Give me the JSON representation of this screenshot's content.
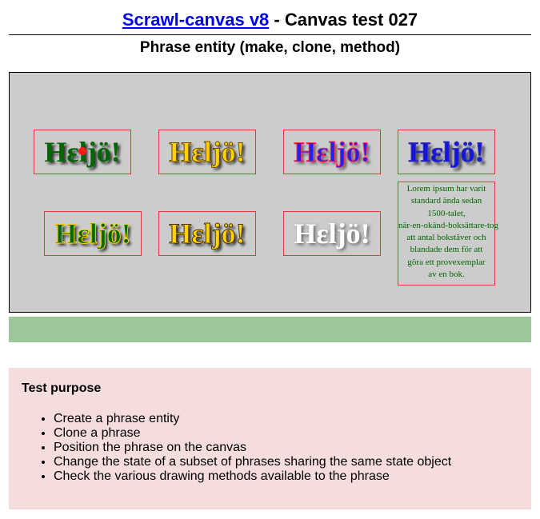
{
  "header": {
    "link_text": "Scrawl-canvas v8",
    "title_suffix": " - Canvas test 027",
    "subtitle": "Phrase entity (make, clone, method)"
  },
  "canvas": {
    "phrases": [
      {
        "text": "Hεljö!",
        "method": "fill"
      },
      {
        "text": "Hεljö!",
        "method": "draw"
      },
      {
        "text": "Hεljö!",
        "method": "drawAndFill"
      },
      {
        "text": "Hεljö!",
        "method": "fillAndDraw"
      },
      {
        "text": "Hεljö!",
        "method": "drawThenFill"
      },
      {
        "text": "Hεljö!",
        "method": "fillThenDraw"
      },
      {
        "text": "Hεljö!",
        "method": "clear"
      }
    ],
    "lorem_lines": [
      "Lorem ipsum har varit",
      "standard ända sedan",
      "1500-talet,",
      "när-en-okänd-boksättare-tog",
      "att antal bokstäver och",
      "blandade dem för att",
      "göra ett provexemplar",
      "av en bok."
    ]
  },
  "purpose": {
    "heading": "Test purpose",
    "items": [
      "Create a phrase entity",
      "Clone a phrase",
      "Position the phrase on the canvas",
      "Change the state of a subset of phrases sharing the same state object",
      "Check the various drawing methods available to the phrase"
    ]
  },
  "colors": {
    "canvas_bg": "#cccccc",
    "box_border": "#e0393a",
    "report_bar": "#9bc79b",
    "purpose_bg": "#f5dcdd",
    "link": "#0000ee"
  }
}
